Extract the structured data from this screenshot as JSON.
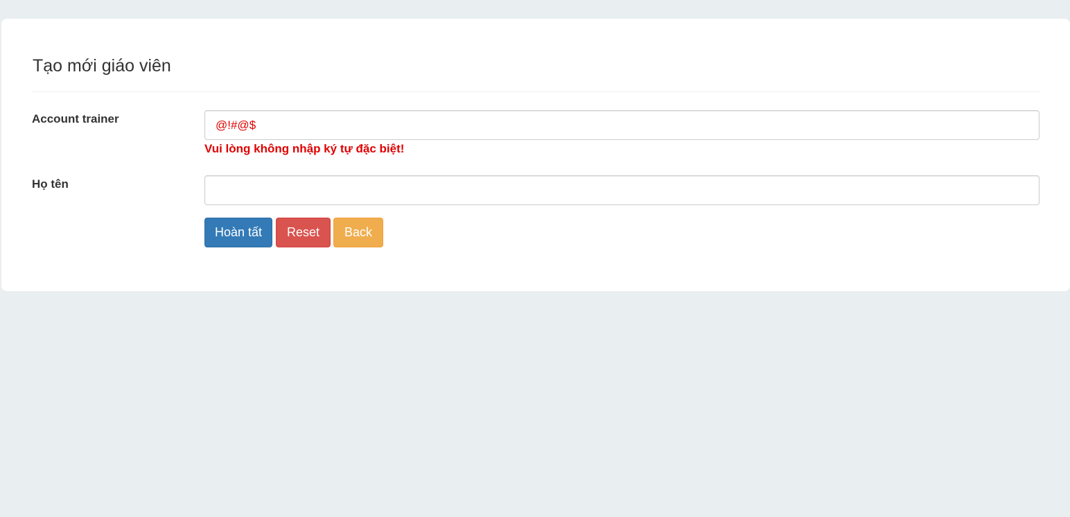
{
  "form": {
    "title": "Tạo mới giáo viên",
    "account_trainer": {
      "label": "Account trainer",
      "value": "@!#@$",
      "error": "Vui lòng không nhập ký tự đặc biệt!"
    },
    "ho_ten": {
      "label": "Họ tên",
      "value": ""
    },
    "buttons": {
      "submit_label": "Hoàn tất",
      "reset_label": "Reset",
      "back_label": "Back"
    }
  },
  "colors": {
    "page_background": "#e9eef1",
    "panel_background": "#ffffff",
    "error": "#e00000",
    "primary": "#337ab7",
    "danger": "#d9534f",
    "warning": "#f0ad4e"
  }
}
